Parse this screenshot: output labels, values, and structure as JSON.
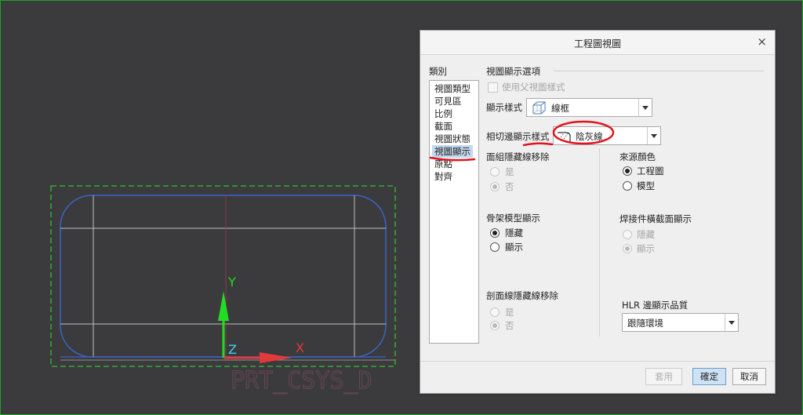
{
  "drawing": {
    "axis_y": "Y",
    "axis_z": "Z",
    "axis_x": "X",
    "csys_label": "PRT_CSYS_D"
  },
  "dialog": {
    "title": "工程圖視圖",
    "close_glyph": "×",
    "category_label": "類別",
    "categories": [
      "視圖類型",
      "可見區",
      "比例",
      "截面",
      "視圖狀態",
      "視圖顯示",
      "原點",
      "對齊"
    ],
    "selected_category": "視圖顯示",
    "options_title": "視圖顯示選項",
    "use_parent_style": "使用父視圖樣式",
    "display_style_label": "顯示樣式",
    "display_style_value": "線框",
    "tangent_edge_label": "相切邊顯示樣式",
    "tangent_edge_value": "陰灰線",
    "face_hidden_removal": {
      "title": "面組隱藏線移除",
      "yes": "是",
      "no": "否"
    },
    "source_color": {
      "title": "來源顏色",
      "opt1": "工程圖",
      "opt2": "模型"
    },
    "skeleton_display": {
      "title": "骨架模型顯示",
      "opt1": "隱藏",
      "opt2": "顯示"
    },
    "weld_section_display": {
      "title": "焊接件橫截面顯示",
      "opt1": "隱藏",
      "opt2": "顯示"
    },
    "section_hidden_removal": {
      "title": "剖面線隱藏線移除",
      "yes": "是",
      "no": "否"
    },
    "hlr_quality": {
      "label": "HLR 邊顯示品質",
      "value": "跟隨環境"
    },
    "buttons": {
      "apply": "套用",
      "ok": "確定",
      "cancel": "取消"
    }
  },
  "colors": {
    "background": "#3b3b3e",
    "viewport_border": "#1aa51a",
    "outline_blue": "#3a63c8",
    "dash_green": "#2fbf2f",
    "annotation_red": "#e0141e",
    "y_axis": "#22dd22",
    "x_axis": "#e23a3a",
    "z_label": "#38d2e8"
  }
}
